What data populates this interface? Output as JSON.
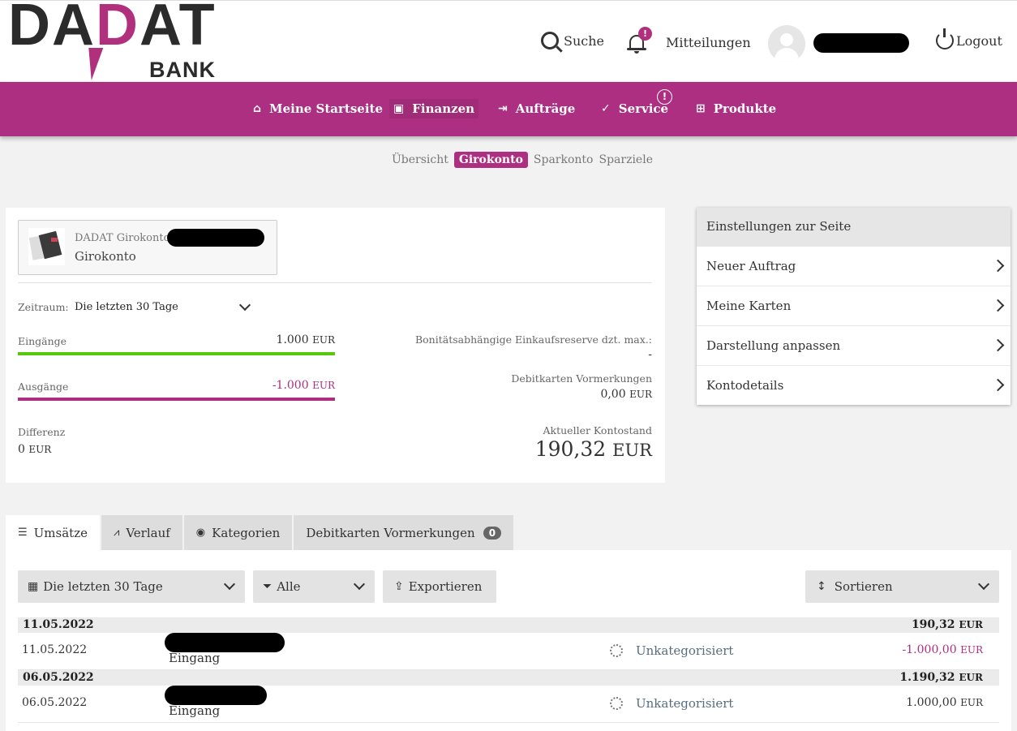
{
  "brand": {
    "logo_text": "DADAT",
    "logo_sub": "BANK",
    "primary_color": "#ad2f82"
  },
  "header": {
    "search_label": "Suche",
    "notifications_label": "Mitteilungen",
    "notifications_badge": "!",
    "logout_label": "Logout"
  },
  "mainnav": {
    "items": [
      {
        "label": "Meine Startseite",
        "icon": "home-icon"
      },
      {
        "label": "Finanzen",
        "icon": "finance-icon"
      },
      {
        "label": "Aufträge",
        "icon": "orders-icon"
      },
      {
        "label": "Service",
        "icon": "check-icon"
      },
      {
        "label": "Produkte",
        "icon": "grid-icon"
      }
    ],
    "active": "Finanzen",
    "service_badge": "!"
  },
  "subnav": {
    "items": [
      "Übersicht",
      "Girokonto",
      "Sparkonto",
      "Sparziele"
    ],
    "active": "Girokonto"
  },
  "account": {
    "bank_line": "DADAT Girokonto /",
    "name": "Girokonto",
    "period_label": "Zeitraum:",
    "period_value": "Die letzten 30 Tage",
    "income_label": "Eingänge",
    "income_value": "1.000",
    "expense_label": "Ausgänge",
    "expense_value": "-1.000",
    "diff_label": "Differenz",
    "diff_value": "0",
    "currency": "EUR",
    "credit_label": "Bonitätsabhängige Einkaufsreserve dzt. max.:",
    "credit_value": "-",
    "debit_label": "Debitkarten Vormerkungen",
    "debit_value": "0,00",
    "balance_label": "Aktueller Kontostand",
    "balance_value": "190,32"
  },
  "settings": {
    "title": "Einstellungen zur Seite",
    "items": [
      "Neuer Auftrag",
      "Meine Karten",
      "Darstellung anpassen",
      "Kontodetails"
    ]
  },
  "tabs": {
    "items": [
      {
        "label": "Umsätze",
        "icon": "list-icon"
      },
      {
        "label": "Verlauf",
        "icon": "trend-icon"
      },
      {
        "label": "Kategorien",
        "icon": "donut-icon"
      },
      {
        "label": "Debitkarten Vormerkungen",
        "icon": ""
      }
    ],
    "debit_count": "0",
    "active": "Umsätze"
  },
  "filters": {
    "period": "Die letzten 30 Tage",
    "type": "Alle",
    "export": "Exportieren",
    "sort": "Sortieren"
  },
  "transactions": [
    {
      "group_date": "11.05.2022",
      "group_amount": "190,32",
      "date": "11.05.2022",
      "desc": "Eingang",
      "category": "Unkategorisiert",
      "amount": "-1.000,00"
    },
    {
      "group_date": "06.05.2022",
      "group_amount": "1.190,32",
      "date": "06.05.2022",
      "desc": "Eingang",
      "category": "Unkategorisiert",
      "amount": "1.000,00"
    }
  ]
}
